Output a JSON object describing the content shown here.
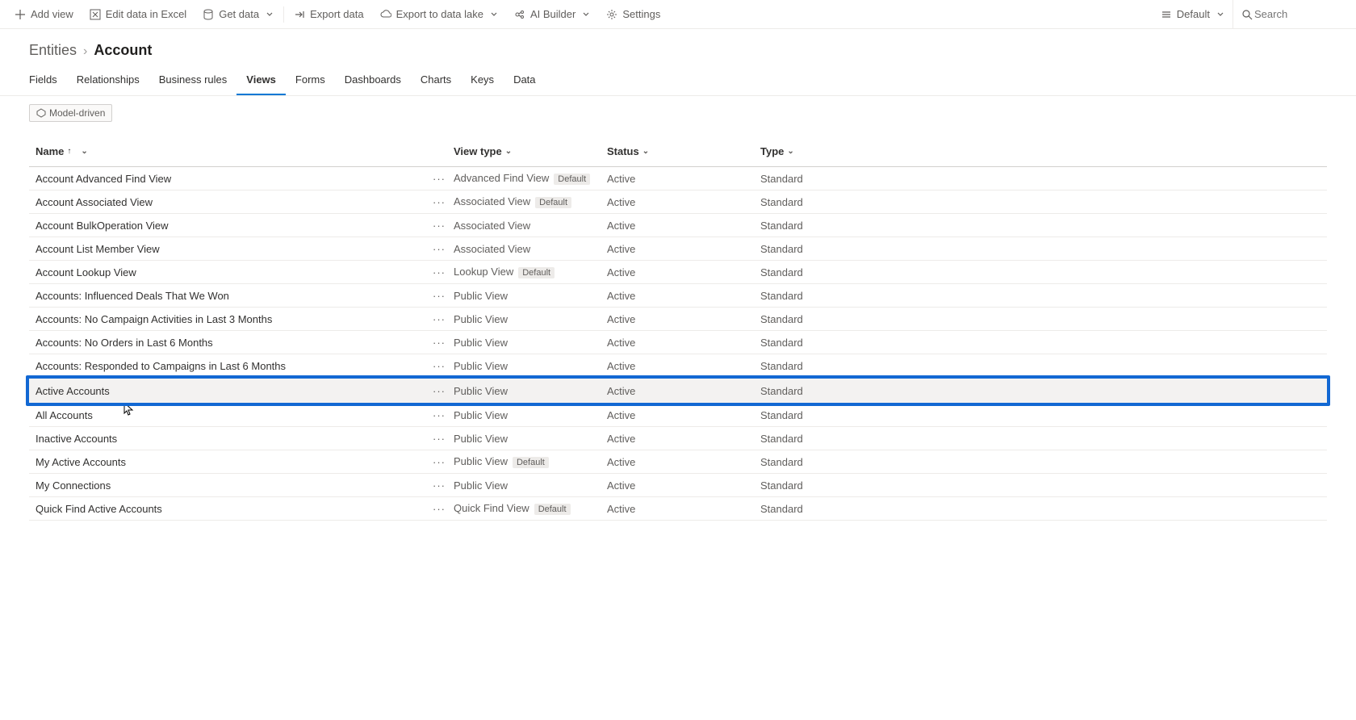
{
  "commandbar": {
    "add_view": "Add view",
    "edit_excel": "Edit data in Excel",
    "get_data": "Get data",
    "export_data": "Export data",
    "export_lake": "Export to data lake",
    "ai_builder": "AI Builder",
    "settings": "Settings",
    "default": "Default",
    "search_placeholder": "Search"
  },
  "breadcrumb": {
    "parent": "Entities",
    "current": "Account"
  },
  "tabs": [
    "Fields",
    "Relationships",
    "Business rules",
    "Views",
    "Forms",
    "Dashboards",
    "Charts",
    "Keys",
    "Data"
  ],
  "active_tab": "Views",
  "chip": "Model-driven",
  "columns": {
    "name": "Name",
    "viewtype": "View type",
    "status": "Status",
    "type": "Type"
  },
  "rows": [
    {
      "name": "Account Advanced Find View",
      "viewtype": "Advanced Find View",
      "default": true,
      "status": "Active",
      "type": "Standard"
    },
    {
      "name": "Account Associated View",
      "viewtype": "Associated View",
      "default": true,
      "status": "Active",
      "type": "Standard"
    },
    {
      "name": "Account BulkOperation View",
      "viewtype": "Associated View",
      "default": false,
      "status": "Active",
      "type": "Standard"
    },
    {
      "name": "Account List Member View",
      "viewtype": "Associated View",
      "default": false,
      "status": "Active",
      "type": "Standard"
    },
    {
      "name": "Account Lookup View",
      "viewtype": "Lookup View",
      "default": true,
      "status": "Active",
      "type": "Standard"
    },
    {
      "name": "Accounts: Influenced Deals That We Won",
      "viewtype": "Public View",
      "default": false,
      "status": "Active",
      "type": "Standard"
    },
    {
      "name": "Accounts: No Campaign Activities in Last 3 Months",
      "viewtype": "Public View",
      "default": false,
      "status": "Active",
      "type": "Standard"
    },
    {
      "name": "Accounts: No Orders in Last 6 Months",
      "viewtype": "Public View",
      "default": false,
      "status": "Active",
      "type": "Standard"
    },
    {
      "name": "Accounts: Responded to Campaigns in Last 6 Months",
      "viewtype": "Public View",
      "default": false,
      "status": "Active",
      "type": "Standard"
    },
    {
      "name": "Active Accounts",
      "viewtype": "Public View",
      "default": false,
      "status": "Active",
      "type": "Standard",
      "highlight": true
    },
    {
      "name": "All Accounts",
      "viewtype": "Public View",
      "default": false,
      "status": "Active",
      "type": "Standard"
    },
    {
      "name": "Inactive Accounts",
      "viewtype": "Public View",
      "default": false,
      "status": "Active",
      "type": "Standard"
    },
    {
      "name": "My Active Accounts",
      "viewtype": "Public View",
      "default": true,
      "status": "Active",
      "type": "Standard"
    },
    {
      "name": "My Connections",
      "viewtype": "Public View",
      "default": false,
      "status": "Active",
      "type": "Standard"
    },
    {
      "name": "Quick Find Active Accounts",
      "viewtype": "Quick Find View",
      "default": true,
      "status": "Active",
      "type": "Standard"
    }
  ],
  "default_badge": "Default"
}
